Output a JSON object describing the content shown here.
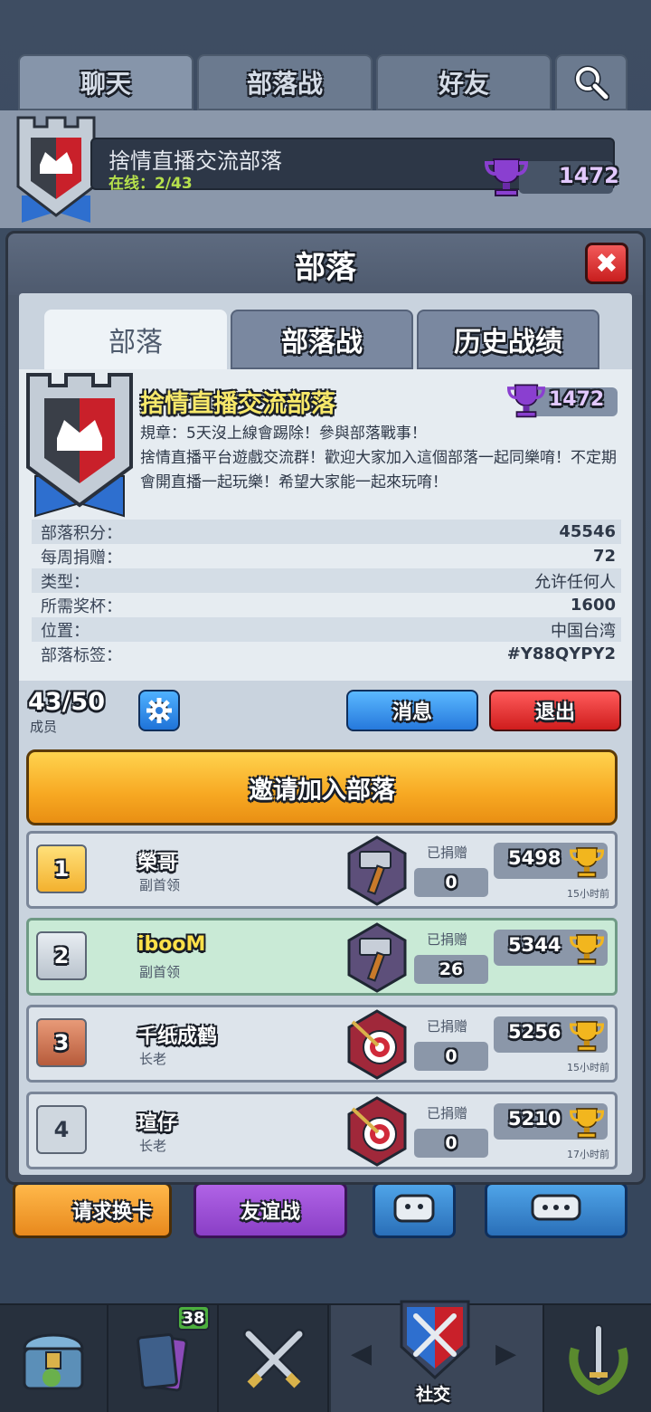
{
  "top_tabs": [
    "聊天",
    "部落战",
    "好友"
  ],
  "bg_clan": {
    "name": "捨情直播交流部落",
    "online": "在线：2/43",
    "trophies": "1472"
  },
  "modal": {
    "title": "部落",
    "close_label": "✖",
    "tabs": [
      "部落",
      "部落战",
      "历史战绩"
    ],
    "clan": {
      "name": "捨情直播交流部落",
      "trophies": "1472",
      "description": "規章：5天沒上線會踢除！參與部落戰事！\n捨情直播平台遊戲交流群！歡迎大家加入這個部落一起同樂唷！不定期會開直播一起玩樂！希望大家能一起來玩唷！"
    },
    "stats": [
      {
        "label": "部落积分：",
        "value": "45546"
      },
      {
        "label": "每周捐赠：",
        "value": "72"
      },
      {
        "label": "类型：",
        "value": "允许任何人"
      },
      {
        "label": "所需奖杯：",
        "value": "1600"
      },
      {
        "label": "位置：",
        "value": "中国台湾"
      },
      {
        "label": "部落标签：",
        "value": "#Y88QYPY2"
      }
    ],
    "members_count": "43/50",
    "members_label": "成员",
    "message_button": "消息",
    "exit_button": "退出",
    "invite_button": "邀请加入部落",
    "donated_label": "已捐赠",
    "members": [
      {
        "rank": "1",
        "name": "榮哥",
        "role": "副首领",
        "donated": "0",
        "trophies": "5498",
        "last_seen": "15小时前"
      },
      {
        "rank": "2",
        "name": "ibooM",
        "role": "副首领",
        "donated": "26",
        "trophies": "5344",
        "last_seen": ""
      },
      {
        "rank": "3",
        "name": "千纸成鹤",
        "role": "长老",
        "donated": "0",
        "trophies": "5256",
        "last_seen": "15小时前"
      },
      {
        "rank": "4",
        "name": "瑄仔",
        "role": "长老",
        "donated": "0",
        "trophies": "5210",
        "last_seen": "17小时前"
      }
    ]
  },
  "bottom_buttons": [
    "请求换卡",
    "友谊战"
  ],
  "bottom_nav": {
    "cards_badge": "38",
    "social_label": "社交"
  },
  "colors": {
    "accent_gold": "#f7a822",
    "accent_blue": "#2679dc",
    "accent_red": "#cf1d1d",
    "trophy_purple": "#8a3fd0"
  }
}
